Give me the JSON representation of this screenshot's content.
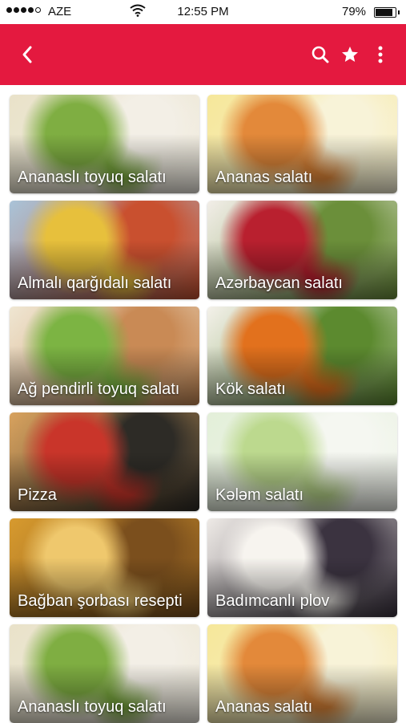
{
  "status_bar": {
    "carrier": "AZE",
    "time": "12:55 PM",
    "battery": "79%",
    "battery_level": 0.79,
    "signal_bars": 4
  },
  "app_bar": {
    "color": "#e4193f",
    "icons": [
      "back-icon",
      "search-icon",
      "star-icon",
      "more-icon"
    ]
  },
  "recipes": [
    {
      "title": "Ananaslı toyuq salatı",
      "colors": [
        "#e9e2c9",
        "#7fae42",
        "#f3efe6"
      ]
    },
    {
      "title": "Ananas salatı",
      "colors": [
        "#f6e79a",
        "#e3893a",
        "#f8f3d8"
      ]
    },
    {
      "title": "Almalı qarğıdalı salatı",
      "colors": [
        "#a9c3d8",
        "#e7c03c",
        "#c9502f"
      ]
    },
    {
      "title": "Azərbaycan salatı",
      "colors": [
        "#f2eee8",
        "#b9202f",
        "#6b8f3a"
      ]
    },
    {
      "title": "Ağ pendirli toyuq salatı",
      "colors": [
        "#efe6d2",
        "#7cb443",
        "#c98a55"
      ]
    },
    {
      "title": "Kök salatı",
      "colors": [
        "#f4f1ea",
        "#e2711d",
        "#5c8a2f"
      ]
    },
    {
      "title": "Pizza",
      "colors": [
        "#d8a25e",
        "#c9352a",
        "#2d2b26"
      ]
    },
    {
      "title": "Kələm salatı",
      "colors": [
        "#e3efd9",
        "#bcd98e",
        "#f5f7f1"
      ]
    },
    {
      "title": "Bağban şorbası resepti",
      "colors": [
        "#d79a2e",
        "#efc86d",
        "#7b4f1d"
      ]
    },
    {
      "title": "Badımcanlı plov",
      "colors": [
        "#eeeae6",
        "#f7f4ef",
        "#3b3340"
      ]
    },
    {
      "title": "Ananaslı toyuq salatı",
      "colors": [
        "#e9e2c9",
        "#7fae42",
        "#f3efe6"
      ]
    },
    {
      "title": "Ananas salatı",
      "colors": [
        "#f6e79a",
        "#e3893a",
        "#f8f3d8"
      ]
    }
  ]
}
